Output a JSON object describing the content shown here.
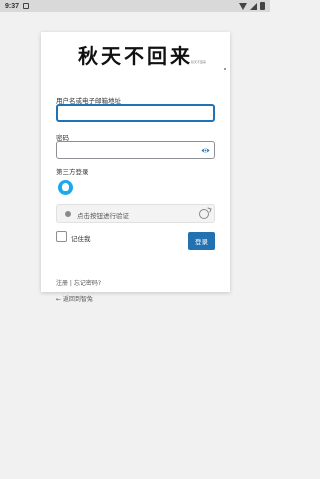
{
  "status_bar": {
    "time": "9:37"
  },
  "logo": {
    "text": "秋天不回来",
    "subtitle": "秋天不回来"
  },
  "form": {
    "username_label": "用户名或电子邮箱地址",
    "username_value": "",
    "password_label": "密码",
    "password_value": "",
    "third_party_label": "第三方登录",
    "verify_text": "点击按钮进行验证",
    "remember_label": "记住我",
    "login_button": "登录"
  },
  "footer": {
    "register": "注册",
    "separator": " | ",
    "forgot": "忘记密码?",
    "back": "← 返回到智兔"
  },
  "colors": {
    "accent": "#2271b1",
    "qq": "#1ea7e9"
  },
  "icons": [
    "notification-icon",
    "wifi-icon",
    "signal-icon",
    "battery-icon",
    "eye-icon",
    "qq-icon",
    "refresh-icon"
  ]
}
